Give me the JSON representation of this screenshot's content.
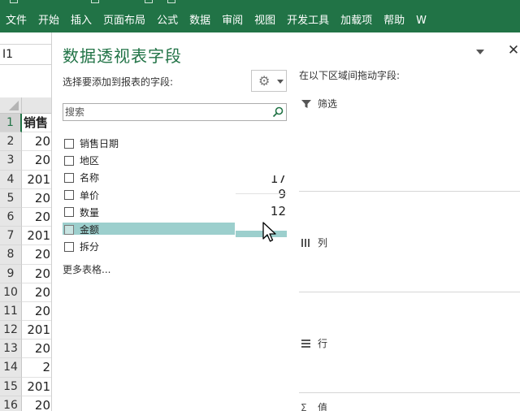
{
  "ribbon": {
    "tabs": [
      "文件",
      "开始",
      "插入",
      "页面布局",
      "公式",
      "数据",
      "审阅",
      "视图",
      "开发工具",
      "加载项",
      "帮助",
      "W"
    ]
  },
  "sheet": {
    "name_box": "I1",
    "header_cell": "销售",
    "rows": [
      {
        "num": "1",
        "value": "销售"
      },
      {
        "num": "2",
        "value": "20"
      },
      {
        "num": "3",
        "value": "20"
      },
      {
        "num": "4",
        "value": "201"
      },
      {
        "num": "5",
        "value": "20"
      },
      {
        "num": "6",
        "value": "20"
      },
      {
        "num": "7",
        "value": "201"
      },
      {
        "num": "8",
        "value": "20"
      },
      {
        "num": "9",
        "value": "20"
      },
      {
        "num": "10",
        "value": "20"
      },
      {
        "num": "11",
        "value": "20"
      },
      {
        "num": "12",
        "value": "201"
      },
      {
        "num": "13",
        "value": "20"
      },
      {
        "num": "14",
        "value": "2"
      },
      {
        "num": "15",
        "value": "201"
      },
      {
        "num": "16",
        "value": "20"
      }
    ]
  },
  "pivot": {
    "title": "数据透视表字段",
    "choose_label": "选择要添加到报表的字段:",
    "search_placeholder": "搜索",
    "fields": [
      "销售日期",
      "地区",
      "名称",
      "单价",
      "数量",
      "金额",
      "拆分"
    ],
    "highlighted_field": "金额",
    "more_tables": "更多表格...",
    "ghost_values": [
      "17",
      "9",
      "12"
    ],
    "areas_label": "在以下区域间拖动字段:",
    "area_filter": "筛选",
    "area_columns": "列",
    "area_rows": "行",
    "area_values": "值",
    "accent_color": "#217346",
    "highlight_color": "#9ccfcd"
  }
}
